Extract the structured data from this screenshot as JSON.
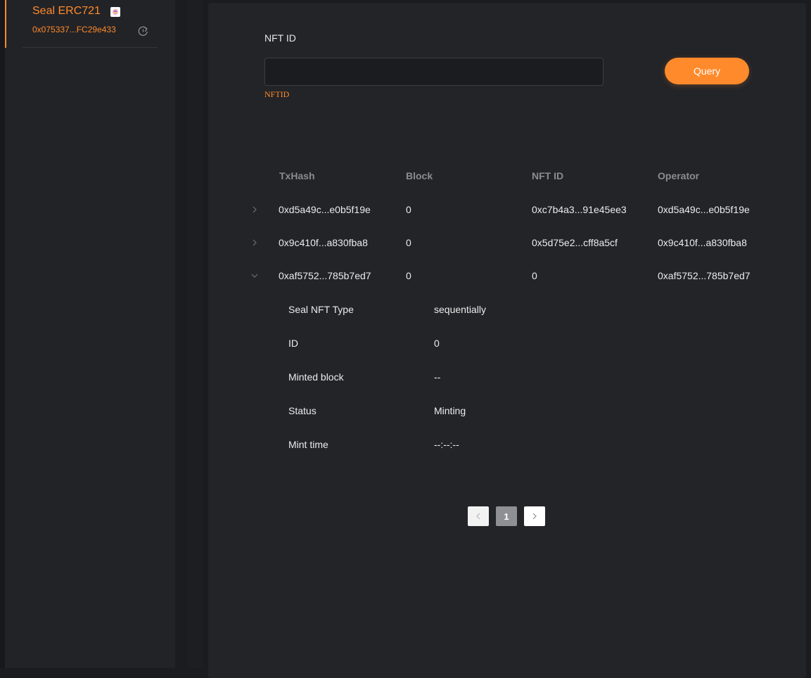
{
  "sidebar": {
    "contract": {
      "name": "Seal ERC721",
      "address": "0x075337...FC29e433"
    }
  },
  "query": {
    "label": "NFT ID",
    "value": "",
    "placeholder": "",
    "hint": "NFTID",
    "button_label": "Query"
  },
  "table": {
    "columns": [
      "TxHash",
      "Block",
      "NFT ID",
      "Operator"
    ],
    "rows": [
      {
        "txhash": "0xd5a49c...e0b5f19e",
        "block": "0",
        "nft_id": "0xc7b4a3...91e45ee3",
        "operator": "0xd5a49c...e0b5f19e",
        "expanded": false
      },
      {
        "txhash": "0x9c410f...a830fba8",
        "block": "0",
        "nft_id": "0x5d75e2...cff8a5cf",
        "operator": "0x9c410f...a830fba8",
        "expanded": false
      },
      {
        "txhash": "0xaf5752...785b7ed7",
        "block": "0",
        "nft_id": "0",
        "operator": "0xaf5752...785b7ed7",
        "expanded": true
      }
    ],
    "details": [
      {
        "label": "Seal NFT Type",
        "value": "sequentially"
      },
      {
        "label": "ID",
        "value": "0"
      },
      {
        "label": "Minted block",
        "value": "--"
      },
      {
        "label": "Status",
        "value": "Minting"
      },
      {
        "label": "Mint time",
        "value": "--:--:--"
      }
    ]
  },
  "pagination": {
    "current_page": "1"
  },
  "colors": {
    "accent": "#ff8a2b",
    "panel": "#232428",
    "background": "#1b1c20",
    "muted_text": "#8b8c91"
  }
}
